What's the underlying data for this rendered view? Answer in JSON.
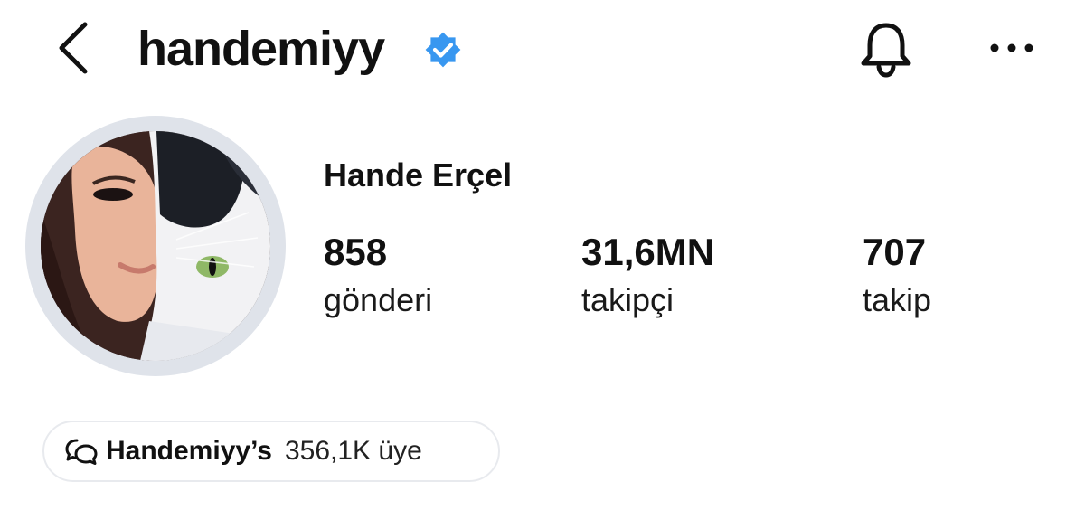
{
  "header": {
    "username": "handemiyy",
    "back_icon": "chevron-left-icon",
    "verified_icon": "verified-badge-icon",
    "bell_icon": "bell-icon",
    "more_icon": "more-horizontal-icon"
  },
  "profile": {
    "full_name": "Hande Erçel",
    "avatar_icon": "profile-photo",
    "stats": {
      "posts": {
        "value": "858",
        "label": "gönderi"
      },
      "followers": {
        "value": "31,6MN",
        "label": "takipçi"
      },
      "following": {
        "value": "707",
        "label": "takip"
      }
    }
  },
  "channel": {
    "icon": "broadcast-channel-icon",
    "name": "Handemiyy’s",
    "members": "356,1K üye"
  },
  "colors": {
    "verified": "#3897f0",
    "ring": "#dfe3ea",
    "pill_border": "#e8eaee"
  }
}
